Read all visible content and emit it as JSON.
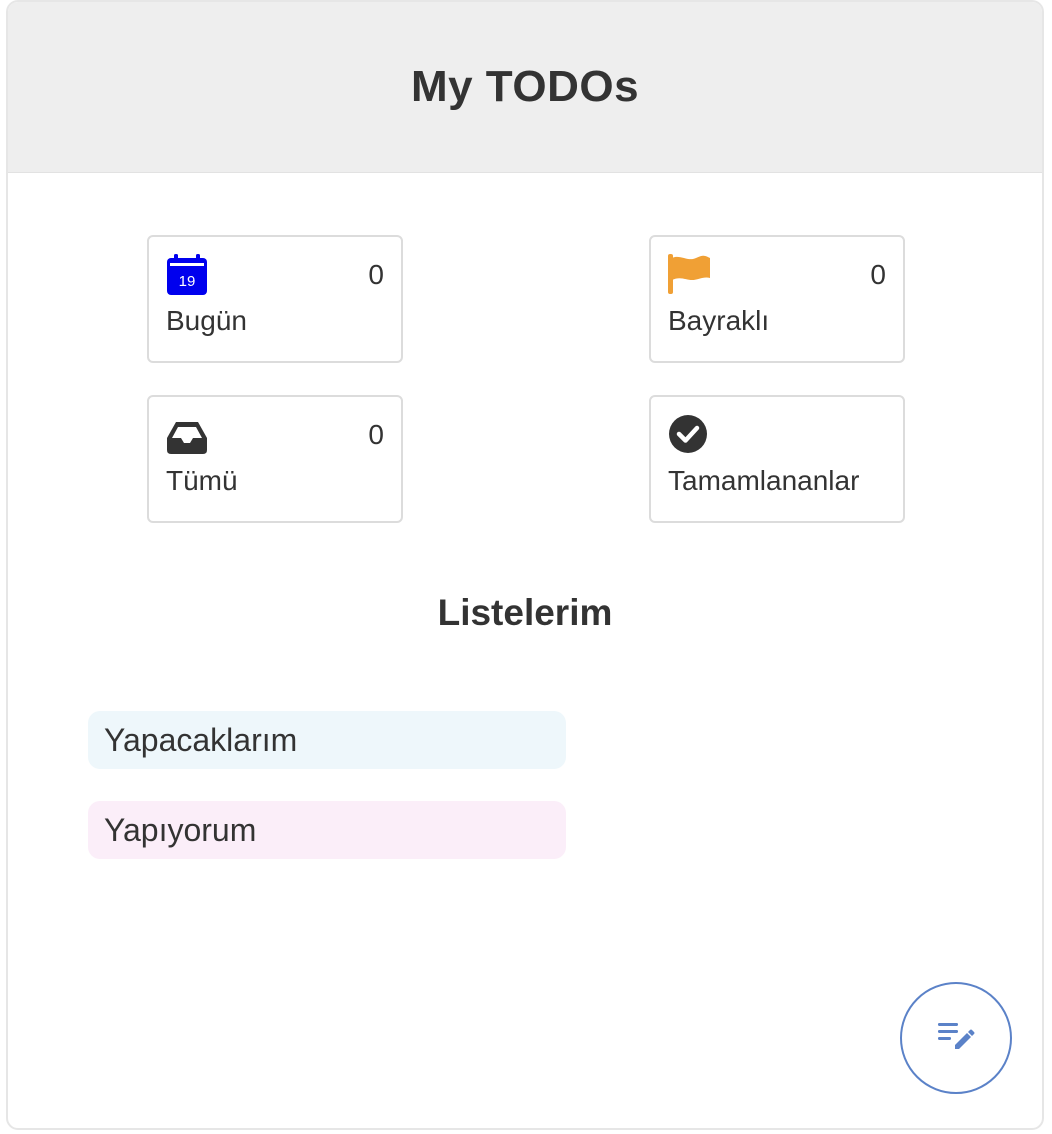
{
  "header": {
    "title": "My TODOs"
  },
  "smart_lists": [
    {
      "label": "Bugün",
      "count": "0",
      "icon": "calendar-icon",
      "icon_color": "#0000ee",
      "icon_day": "19"
    },
    {
      "label": "Bayraklı",
      "count": "0",
      "icon": "flag-icon",
      "icon_color": "#f0a035"
    },
    {
      "label": "Tümü",
      "count": "0",
      "icon": "inbox-tray-icon",
      "icon_color": "#333333"
    },
    {
      "label": "Tamamlananlar",
      "count": "",
      "icon": "check-circle-icon",
      "icon_color": "#333333"
    }
  ],
  "my_lists": {
    "title": "Listelerim",
    "items": [
      {
        "label": "Yapacaklarım",
        "color": "#eef7fb"
      },
      {
        "label": "Yapıyorum",
        "color": "#fbeef9"
      }
    ]
  },
  "fab": {
    "icon": "edit-list-icon",
    "color": "#5b82c8"
  }
}
